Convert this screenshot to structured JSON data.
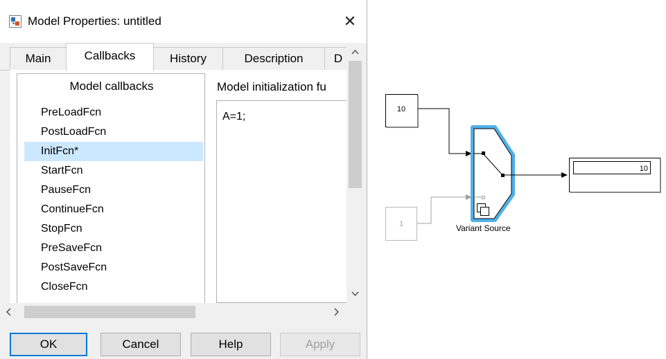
{
  "dialog": {
    "title": "Model Properties: untitled",
    "close_glyph": "✕",
    "tabs": [
      {
        "label": "Main"
      },
      {
        "label": "Callbacks"
      },
      {
        "label": "History"
      },
      {
        "label": "Description"
      },
      {
        "label": "D"
      }
    ],
    "active_tab": "Callbacks",
    "callbacks_header": "Model callbacks",
    "callbacks": [
      "PreLoadFcn",
      "PostLoadFcn",
      "InitFcn*",
      "StartFcn",
      "PauseFcn",
      "ContinueFcn",
      "StopFcn",
      "PreSaveFcn",
      "PostSaveFcn",
      "CloseFcn"
    ],
    "selected_callback": "InitFcn*",
    "editor_label": "Model initialization fu",
    "editor_content": "A=1;",
    "buttons": {
      "ok": "OK",
      "cancel": "Cancel",
      "help": "Help",
      "apply": "Apply"
    },
    "icons": {
      "app": "simulink-model-icon",
      "scroll_up": "chevron-up-icon",
      "scroll_down": "chevron-down-icon",
      "scroll_left": "chevron-left-icon",
      "scroll_right": "chevron-right-icon"
    },
    "colors": {
      "selection": "#cce8ff",
      "default_button_border": "#0078d7"
    }
  },
  "diagram": {
    "constant_active": "10",
    "constant_inactive": "1",
    "display_value": "10",
    "variant_label": "Variant Source",
    "colors": {
      "variant_highlight": "#4fb0e8",
      "inactive": "#b0b0b0"
    }
  }
}
